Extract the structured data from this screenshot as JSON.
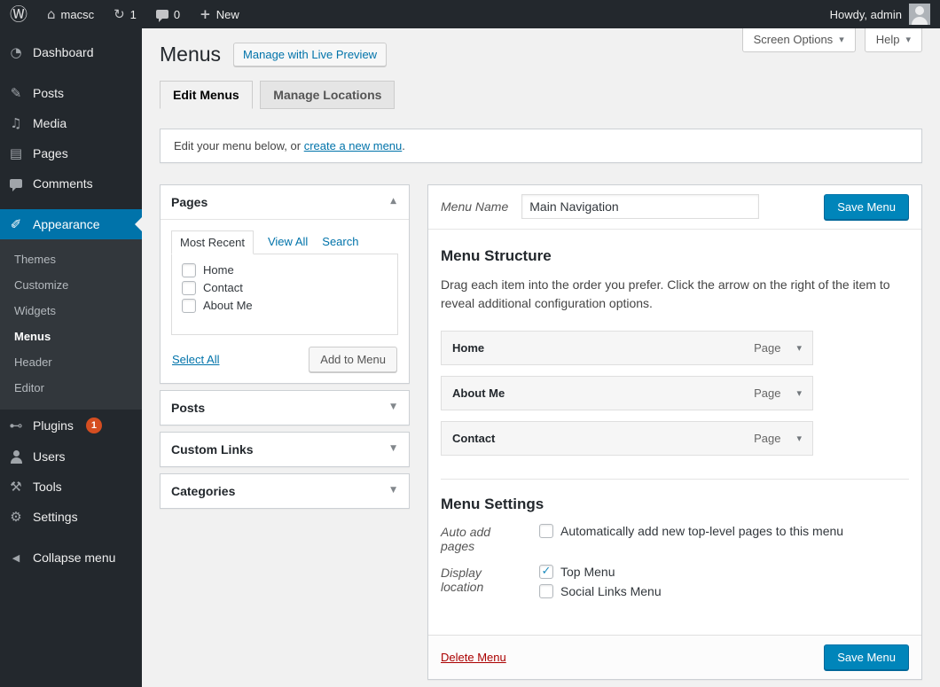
{
  "admin_bar": {
    "site_name": "macsc",
    "updates_count": "1",
    "comments_count": "0",
    "new_label": "New",
    "howdy_text": "Howdy, admin"
  },
  "sidebar": {
    "items": [
      {
        "label": "Dashboard"
      },
      {
        "label": "Posts"
      },
      {
        "label": "Media"
      },
      {
        "label": "Pages"
      },
      {
        "label": "Comments"
      },
      {
        "label": "Appearance"
      },
      {
        "label": "Plugins",
        "badge": "1"
      },
      {
        "label": "Users"
      },
      {
        "label": "Tools"
      },
      {
        "label": "Settings"
      },
      {
        "label": "Collapse menu"
      }
    ],
    "appearance_submenu": [
      {
        "label": "Themes"
      },
      {
        "label": "Customize"
      },
      {
        "label": "Widgets"
      },
      {
        "label": "Menus"
      },
      {
        "label": "Header"
      },
      {
        "label": "Editor"
      }
    ]
  },
  "screen_meta": {
    "screen_options_label": "Screen Options",
    "help_label": "Help"
  },
  "page": {
    "title": "Menus",
    "live_preview_button": "Manage with Live Preview",
    "tabs": [
      {
        "label": "Edit Menus",
        "active": true
      },
      {
        "label": "Manage Locations",
        "active": false
      }
    ],
    "notice_prefix": "Edit your menu below, or ",
    "notice_link": "create a new menu",
    "notice_suffix": "."
  },
  "boxes": {
    "pages": {
      "title": "Pages",
      "tabs": [
        {
          "label": "Most Recent",
          "active": true
        },
        {
          "label": "View All",
          "active": false
        },
        {
          "label": "Search",
          "active": false
        }
      ],
      "items": [
        {
          "label": "Home",
          "checked": false
        },
        {
          "label": "Contact",
          "checked": false
        },
        {
          "label": "About Me",
          "checked": false
        }
      ],
      "select_all_label": "Select All",
      "add_to_menu_label": "Add to Menu"
    },
    "posts_title": "Posts",
    "custom_links_title": "Custom Links",
    "categories_title": "Categories"
  },
  "editor": {
    "menu_name_label": "Menu Name",
    "menu_name_value": "Main Navigation",
    "save_button_label": "Save Menu",
    "structure": {
      "heading": "Menu Structure",
      "description": "Drag each item into the order you prefer. Click the arrow on the right of the item to reveal additional configuration options.",
      "items": [
        {
          "label": "Home",
          "type": "Page"
        },
        {
          "label": "About Me",
          "type": "Page"
        },
        {
          "label": "Contact",
          "type": "Page"
        }
      ]
    },
    "settings": {
      "heading": "Menu Settings",
      "auto_add_label": "Auto add pages",
      "auto_add_option": "Automatically add new top-level pages to this menu",
      "auto_add_checked": false,
      "display_location_label": "Display location",
      "locations": [
        {
          "label": "Top Menu",
          "checked": true
        },
        {
          "label": "Social Links Menu",
          "checked": false
        }
      ]
    },
    "delete_link_label": "Delete Menu"
  },
  "icons": {
    "wordpress": "Ⓦ",
    "home": "⌂",
    "updates": "↻",
    "plus": "+",
    "dashboard": "◔",
    "posts": "✎",
    "media": "♫",
    "pages": "▤",
    "appearance": "✐",
    "plugins": "⊷",
    "tools": "⚒",
    "settings": "⚙",
    "collapse": "◀",
    "chevron_down": "▾",
    "triangle_up": "▲",
    "triangle_down": "▼",
    "check": "✓"
  },
  "colors": {
    "accent_blue": "#0073aa",
    "button_primary_blue": "#0085ba",
    "badge_red": "#d54e21",
    "delete_red": "#a00",
    "admin_dark": "#23282d"
  }
}
